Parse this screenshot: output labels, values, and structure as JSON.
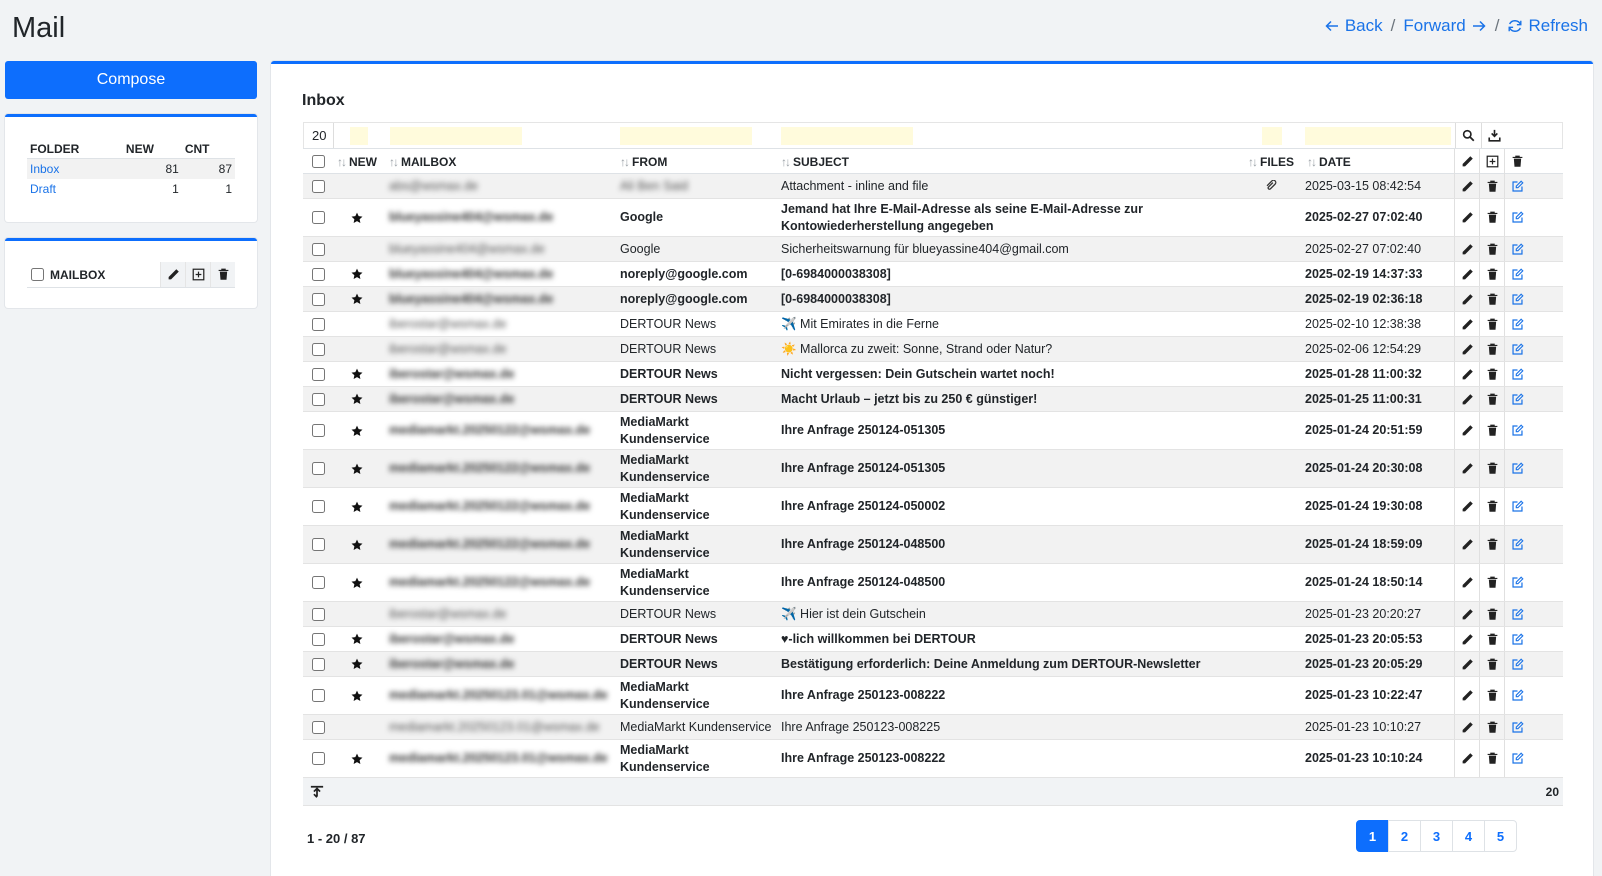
{
  "app_title": "Mail",
  "nav": {
    "back": "Back",
    "forward": "Forward",
    "separator": "/",
    "refresh": "Refresh"
  },
  "compose_label": "Compose",
  "folders": {
    "headers": [
      "FOLDER",
      "NEW",
      "CNT"
    ],
    "items": [
      {
        "name": "Inbox",
        "new": "81",
        "cnt": "87"
      },
      {
        "name": "Draft",
        "new": "1",
        "cnt": "1"
      }
    ]
  },
  "mailbox_panel": {
    "label": "MAILBOX"
  },
  "inbox": {
    "title": "Inbox",
    "page_size": "20",
    "headers": {
      "new": "NEW",
      "mailbox": "MAILBOX",
      "from": "FROM",
      "subject": "SUBJECT",
      "files": "FILES",
      "date": "DATE"
    },
    "rows": [
      {
        "mailbox": "abs@wsmax.de",
        "from": "Ali Ben Said",
        "subject": "Attachment - inline and file",
        "date": "2025-03-15 08:42:54",
        "new": false,
        "attach": true,
        "blur_from": true
      },
      {
        "mailbox": "blueyassine404@wsmax.de",
        "from": "Google",
        "subject": "Jemand hat Ihre E-Mail-Adresse als seine E-Mail-Adresse zur Kontowiederherstellung angegeben",
        "date": "2025-02-27 07:02:40",
        "new": true
      },
      {
        "mailbox": "blueyassine404@wsmax.de",
        "from": "Google",
        "subject": "Sicherheitswarnung für blueyassine404@gmail.com",
        "date": "2025-02-27 07:02:40",
        "new": false
      },
      {
        "mailbox": "blueyassine404@wsmax.de",
        "from": "noreply@google.com",
        "subject": "[0-6984000038308]",
        "date": "2025-02-19 14:37:33",
        "new": true
      },
      {
        "mailbox": "blueyassine404@wsmax.de",
        "from": "noreply@google.com",
        "subject": "[0-6984000038308]",
        "date": "2025-02-19 02:36:18",
        "new": true
      },
      {
        "mailbox": "iberostar@wsmax.de",
        "from": "DERTOUR News",
        "subject": "✈️ Mit Emirates in die Ferne",
        "date": "2025-02-10 12:38:38",
        "new": false
      },
      {
        "mailbox": "iberostar@wsmax.de",
        "from": "DERTOUR News",
        "subject": "☀️ Mallorca zu zweit: Sonne, Strand oder Natur?",
        "date": "2025-02-06 12:54:29",
        "new": false
      },
      {
        "mailbox": "iberostar@wsmax.de",
        "from": "DERTOUR News",
        "subject": "Nicht vergessen: Dein Gutschein wartet noch!",
        "date": "2025-01-28 11:00:32",
        "new": true
      },
      {
        "mailbox": "iberostar@wsmax.de",
        "from": "DERTOUR News",
        "subject": "Macht Urlaub – jetzt bis zu 250 € günstiger!",
        "date": "2025-01-25 11:00:31",
        "new": true
      },
      {
        "mailbox": "mediamarkt.20250122@wsmax.de",
        "from": "MediaMarkt Kundenservice",
        "subject": "Ihre Anfrage 250124-051305",
        "date": "2025-01-24 20:51:59",
        "new": true
      },
      {
        "mailbox": "mediamarkt.20250122@wsmax.de",
        "from": "MediaMarkt Kundenservice",
        "subject": "Ihre Anfrage 250124-051305",
        "date": "2025-01-24 20:30:08",
        "new": true
      },
      {
        "mailbox": "mediamarkt.20250122@wsmax.de",
        "from": "MediaMarkt Kundenservice",
        "subject": "Ihre Anfrage 250124-050002",
        "date": "2025-01-24 19:30:08",
        "new": true
      },
      {
        "mailbox": "mediamarkt.20250122@wsmax.de",
        "from": "MediaMarkt Kundenservice",
        "subject": "Ihre Anfrage 250124-048500",
        "date": "2025-01-24 18:59:09",
        "new": true
      },
      {
        "mailbox": "mediamarkt.20250122@wsmax.de",
        "from": "MediaMarkt Kundenservice",
        "subject": "Ihre Anfrage 250124-048500",
        "date": "2025-01-24 18:50:14",
        "new": true
      },
      {
        "mailbox": "iberostar@wsmax.de",
        "from": "DERTOUR News",
        "subject": "✈️ Hier ist dein Gutschein",
        "date": "2025-01-23 20:20:27",
        "new": false
      },
      {
        "mailbox": "iberostar@wsmax.de",
        "from": "DERTOUR News",
        "subject": "♥-lich willkommen bei DERTOUR",
        "date": "2025-01-23 20:05:53",
        "new": true
      },
      {
        "mailbox": "iberostar@wsmax.de",
        "from": "DERTOUR News",
        "subject": "Bestätigung erforderlich: Deine Anmeldung zum DERTOUR-Newsletter",
        "date": "2025-01-23 20:05:29",
        "new": true
      },
      {
        "mailbox": "mediamarkt.20250123.01@wsmax.de",
        "from": "MediaMarkt Kundenservice",
        "subject": "Ihre Anfrage 250123-008222",
        "date": "2025-01-23 10:22:47",
        "new": true
      },
      {
        "mailbox": "mediamarkt.20250123.01@wsmax.de",
        "from": "MediaMarkt Kundenservice",
        "subject": "Ihre Anfrage 250123-008225",
        "date": "2025-01-23 10:10:27",
        "new": false
      },
      {
        "mailbox": "mediamarkt.20250123.01@wsmax.de",
        "from": "MediaMarkt Kundenservice",
        "subject": "Ihre Anfrage 250123-008222",
        "date": "2025-01-23 10:10:24",
        "new": true
      }
    ],
    "footer_count": "20",
    "page_info": "1 - 20 / 87",
    "pages": [
      "1",
      "2",
      "3",
      "4",
      "5"
    ],
    "active_page": "1"
  },
  "colors": {
    "accent": "#0d6efd",
    "link": "#1a73e8",
    "filter_bg": "#fffbdc"
  },
  "icons": [
    "arrow-left-icon",
    "arrow-right-icon",
    "refresh-icon",
    "search-icon",
    "download-icon",
    "pencil-icon",
    "add-box-icon",
    "trash-icon",
    "edit-box-icon",
    "star-icon",
    "paperclip-icon",
    "collapse-icon"
  ]
}
